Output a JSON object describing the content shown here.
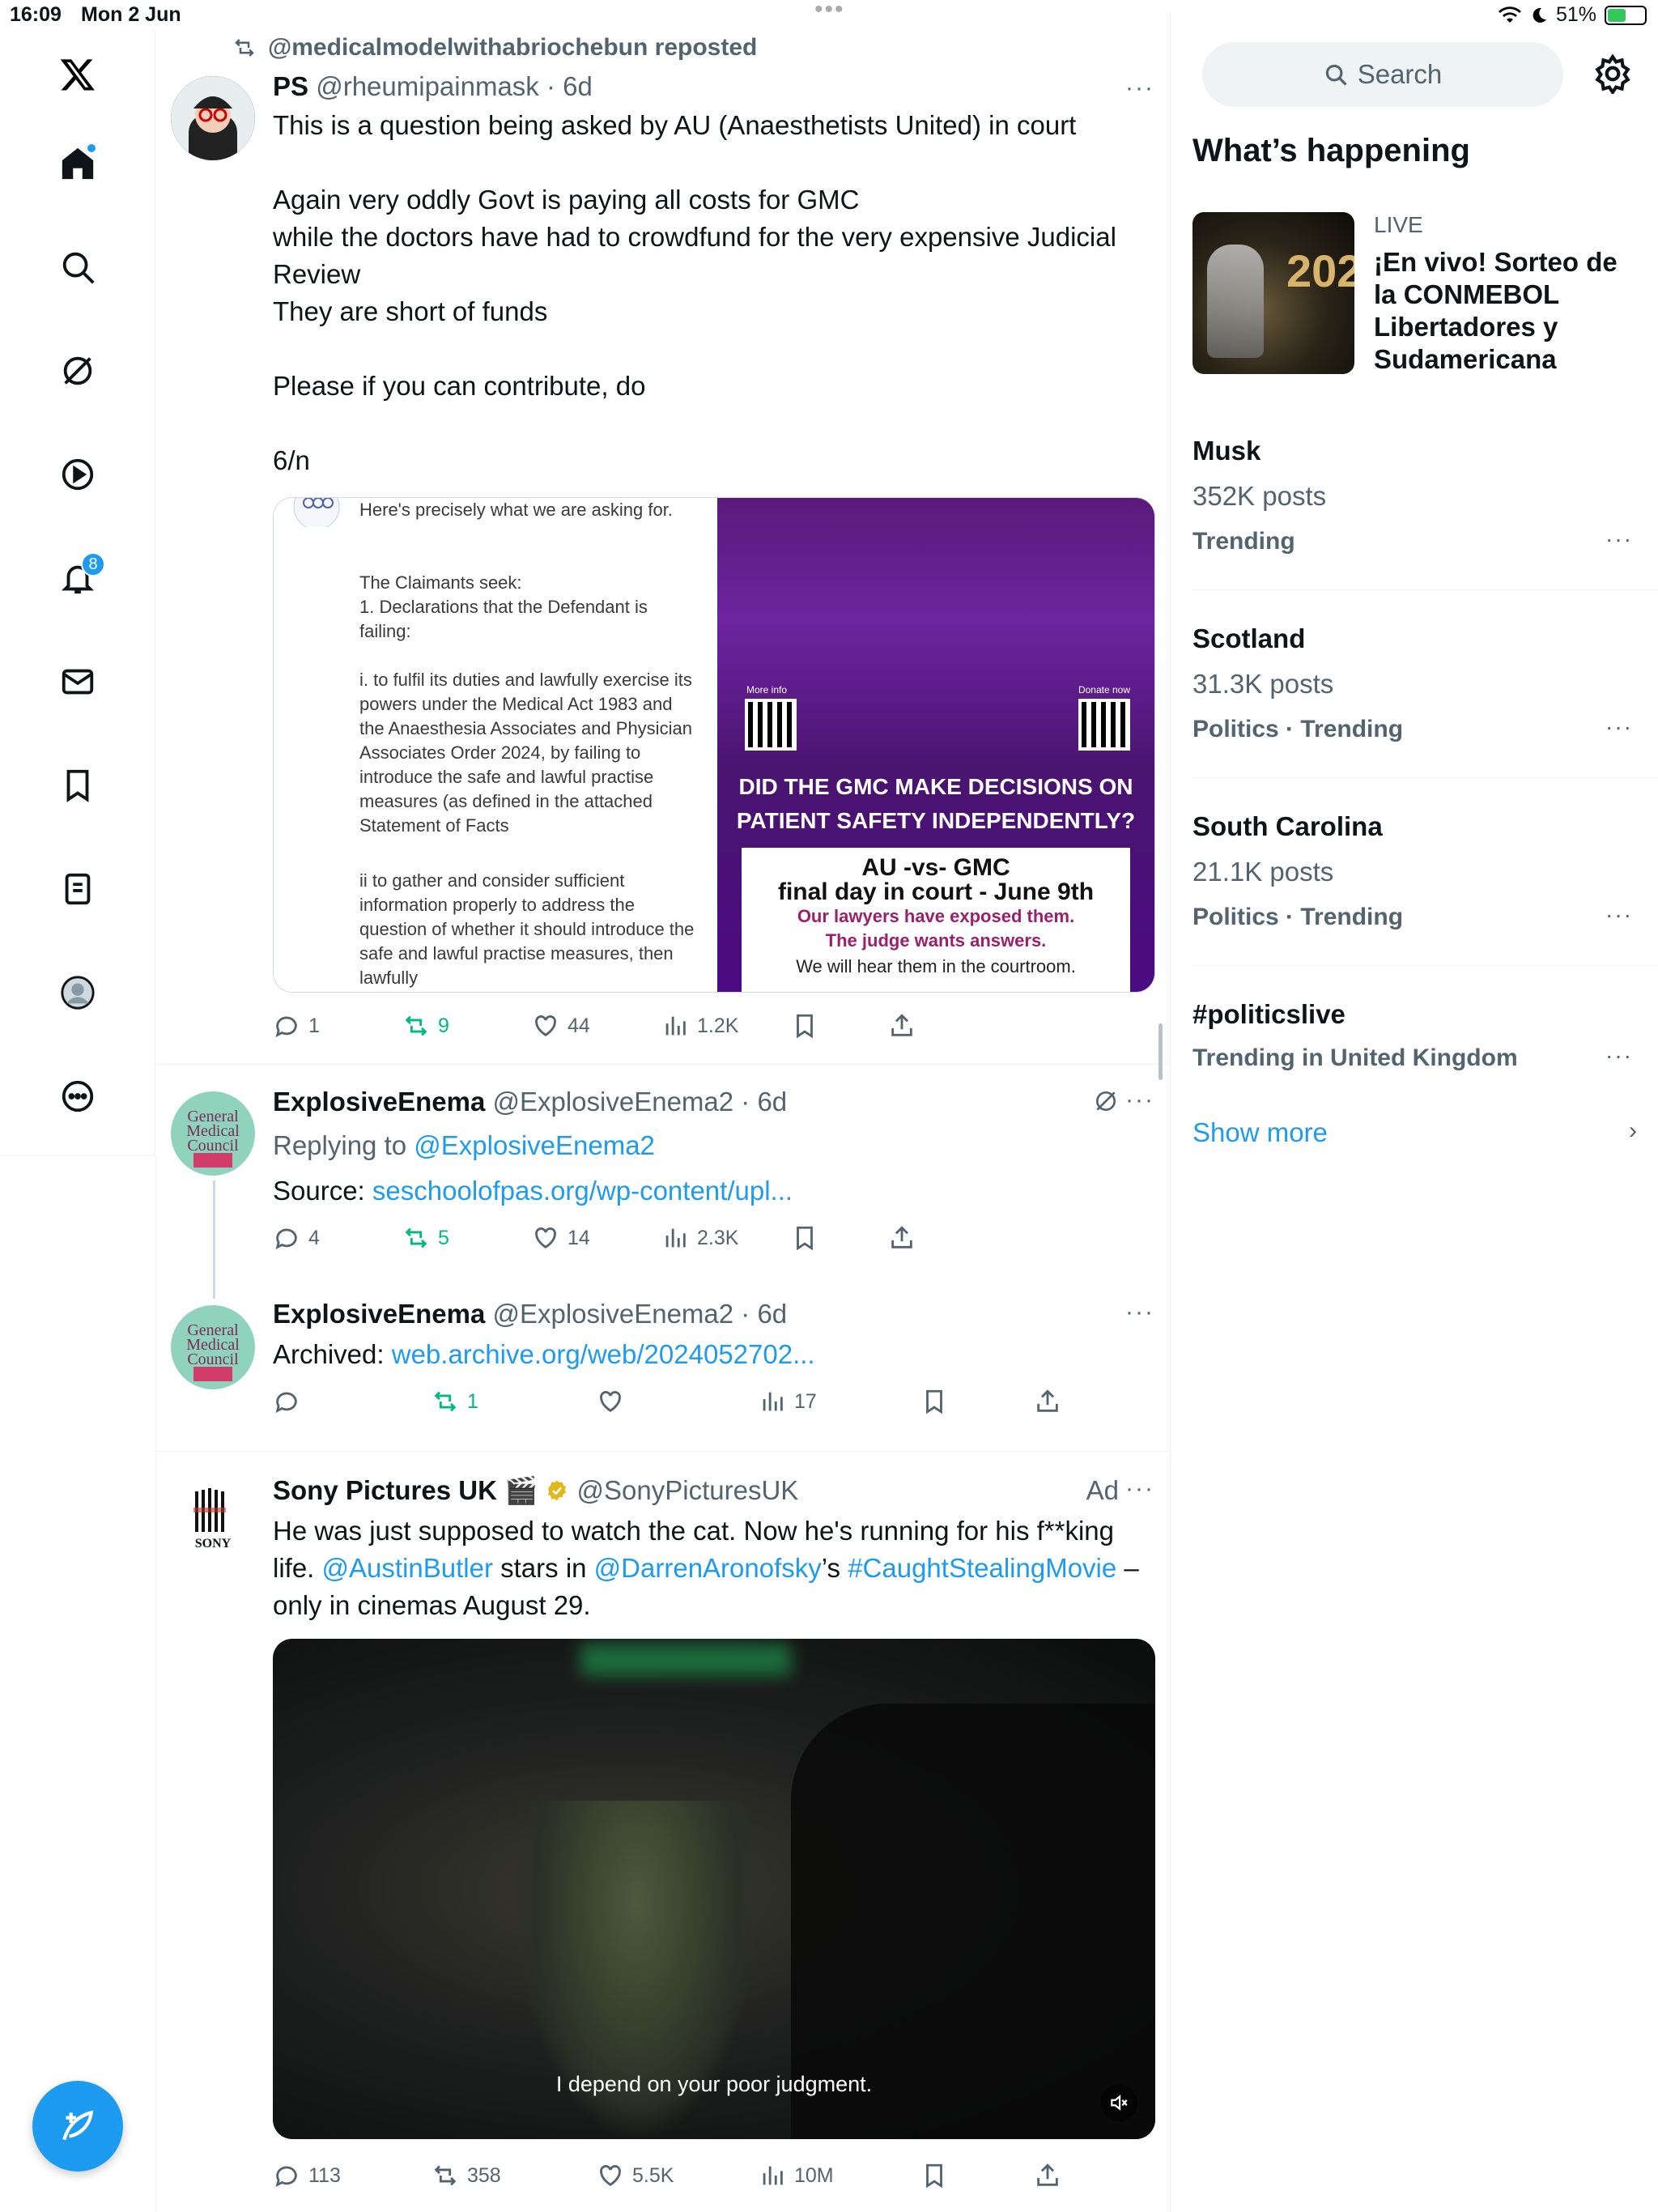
{
  "status_bar": {
    "time": "16:09",
    "date": "Mon 2 Jun",
    "battery": "51%",
    "battery_level": 0.51
  },
  "nav": {
    "notifications_count": "8"
  },
  "feed": {
    "post1": {
      "repost_label": "@medicalmodelwithabriochebun reposted",
      "name": "PS",
      "handle_time": "@rheumipainmask · 6d",
      "text": "This is a question being asked by AU (Anaesthetists United) in court\n\nAgain very oddly Govt is paying all costs for GMC\nwhile the doctors have had to crowdfund for the very expensive Judicial Review\nThey are short of funds\n\nPlease if you can contribute, do\n\n6/n",
      "media": {
        "doc_intro": "Here's precisely what we are asking for.",
        "doc_seek": "The Claimants seek:",
        "doc_item1": "1.  Declarations that the Defendant is failing:",
        "doc_item_i": "i. to fulfil its duties and lawfully exercise its powers under the Medical Act 1983 and the Anaesthesia Associates and Physician Associates Order 2024, by failing to introduce the safe and lawful practise measures (as defined in the attached Statement of Facts",
        "doc_item_ii": "ii to gather and consider sufficient information properly to address the question of whether it should introduce the safe and lawful practise measures, then lawfully",
        "qr_left": "More info",
        "qr_right": "Donate now",
        "headline": "DID THE GMC MAKE DECISIONS ON PATIENT SAFETY INDEPENDENTLY?",
        "box_title": "AU -vs- GMC",
        "box_subtitle": "final day in court - June 9th",
        "box_line1": "Our lawyers have exposed them.",
        "box_line2": "The judge wants answers.",
        "box_line3": "We will hear them in the courtroom."
      },
      "replies": "1",
      "reposts": "9",
      "likes": "44",
      "views": "1.2K"
    },
    "post2": {
      "name": "ExplosiveEnema",
      "handle_time": "@ExplosiveEnema2 · 6d",
      "replying_prefix": "Replying to ",
      "replying_to": "@ExplosiveEnema2",
      "source_prefix": "Source: ",
      "source_link": "seschoolofpas.org/wp-content/upl...",
      "replies": "4",
      "reposts": "5",
      "likes": "14",
      "views": "2.3K"
    },
    "post3": {
      "name": "ExplosiveEnema",
      "handle_time": "@ExplosiveEnema2 · 6d",
      "archived_prefix": "Archived: ",
      "archived_link": "web.archive.org/web/2024052702...",
      "reposts": "1",
      "views": "17"
    },
    "avatar_text": "General Medical Council",
    "ad": {
      "name": "Sony Pictures UK 🎬",
      "handle": "@SonyPicturesUK",
      "ad_label": "Ad",
      "logo_text": "SONY",
      "text_part1": "He was just supposed to watch the cat. Now he's running for his f**king life. ",
      "mention1": "@AustinButler",
      "text_part2": " stars in ",
      "mention2": "@DarrenAronofsky",
      "text_part3": "’s ",
      "hashtag": "#CaughtStealingMovie",
      "text_part4": " – only in cinemas August 29.",
      "subtitle": "I depend on your poor judgment.",
      "replies": "113",
      "reposts": "358",
      "likes": "5.5K",
      "views": "10M"
    }
  },
  "sidebar": {
    "search_placeholder": "Search",
    "heading": "What’s happening",
    "live": {
      "label": "LIVE",
      "title": "¡En vivo! Sorteo de la CONMEBOL Libertadores y Sudamericana",
      "thumb_text": "202"
    },
    "trends": [
      {
        "title": "Musk",
        "count": "352K posts",
        "category": "Trending"
      },
      {
        "title": "Scotland",
        "count": "31.3K posts",
        "category": "Politics · Trending"
      },
      {
        "title": "South Carolina",
        "count": "21.1K posts",
        "category": "Politics · Trending"
      },
      {
        "title": "#politicslive",
        "count": "",
        "category": "Trending in United Kingdom"
      }
    ],
    "show_more": "Show more"
  },
  "colors": {
    "accent": "#1d9bf0",
    "repost_green": "#00ba7c",
    "muted": "#536471"
  }
}
